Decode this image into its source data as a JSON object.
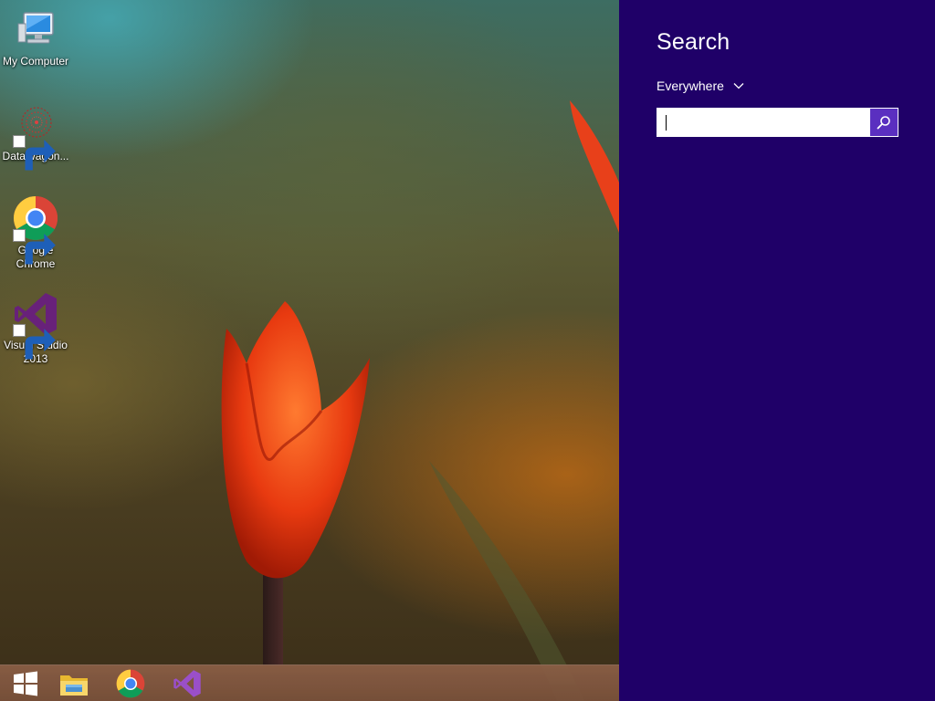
{
  "desktop": {
    "icons": [
      {
        "name": "My Computer",
        "icon": "computer-icon"
      },
      {
        "name": "DataWagon...",
        "icon": "datawagon-icon"
      },
      {
        "name": "Google\nChrome",
        "icon": "chrome-icon"
      },
      {
        "name": "Visual Studio\n2013",
        "icon": "visual-studio-icon"
      }
    ]
  },
  "taskbar": {
    "items": [
      {
        "icon": "windows-start-icon"
      },
      {
        "icon": "file-explorer-icon"
      },
      {
        "icon": "chrome-icon"
      },
      {
        "icon": "visual-studio-icon"
      }
    ]
  },
  "search_charm": {
    "title": "Search",
    "scope": "Everywhere",
    "input_value": "",
    "search_button_icon": "search-icon"
  },
  "colors": {
    "charm_background": "#1f0068",
    "search_button": "#5a2fc0",
    "taskbar": "#8a5e46"
  }
}
